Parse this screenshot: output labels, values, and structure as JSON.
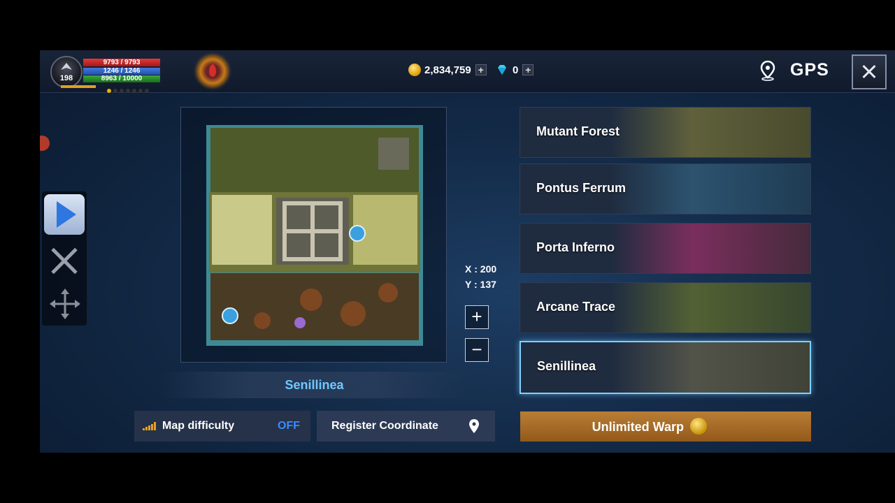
{
  "player": {
    "level": "198",
    "hp": "9793 / 9793",
    "mp": "1246 / 1246",
    "xp": "8963 / 10000"
  },
  "currency": {
    "gold": "2,834,759",
    "gems": "0",
    "plus": "+"
  },
  "header": {
    "gps_label": "GPS"
  },
  "map": {
    "name": "Senillinea",
    "x_coord": "X : 200",
    "y_coord": "Y : 137",
    "zoom_in": "+",
    "zoom_out": "−"
  },
  "controls": {
    "difficulty_label": "Map difficulty",
    "difficulty_value": "OFF",
    "register_label": "Register Coordinate",
    "warp_label": "Unlimited Warp"
  },
  "regions": [
    {
      "label": "Mutant Forest",
      "tint": "#6b6a3a"
    },
    {
      "label": "Pontus Ferrum",
      "tint": "#2f5a78"
    },
    {
      "label": "Porta Inferno",
      "tint": "#8a2f62"
    },
    {
      "label": "Arcane Trace",
      "tint": "#5c6a32"
    },
    {
      "label": "Senillinea",
      "tint": "#5b5a4a",
      "selected": true
    }
  ],
  "colors": {
    "accent_blue": "#6fc8ff",
    "off_blue": "#3a8cff",
    "warp_orange": "#b97e35"
  }
}
